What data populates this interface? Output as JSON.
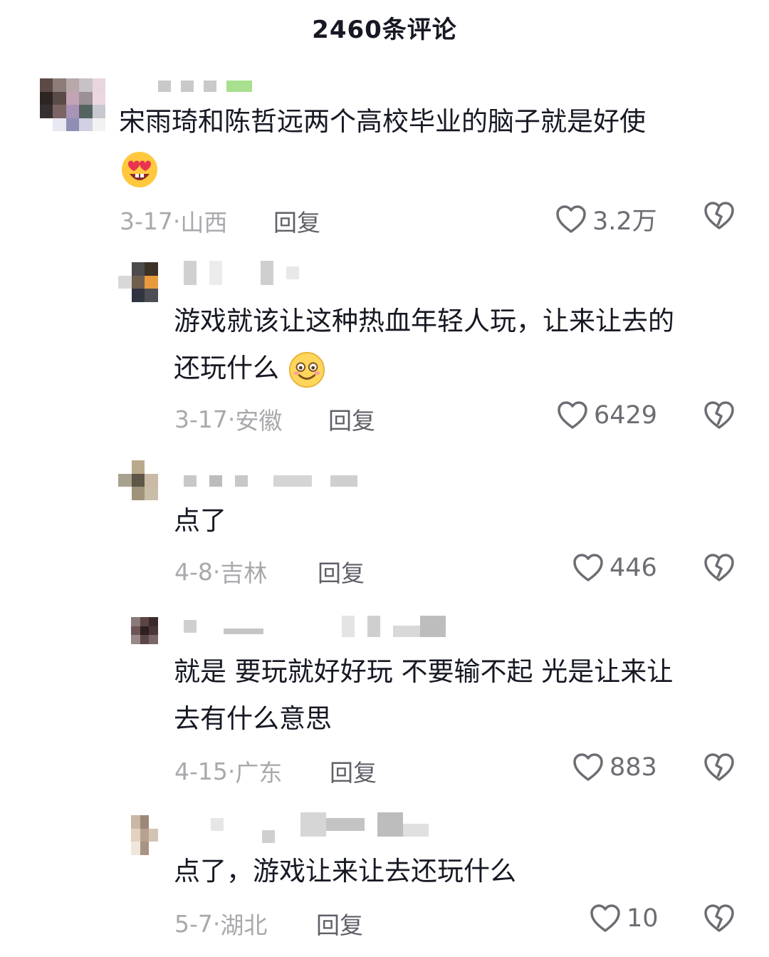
{
  "header": {
    "title": "2460条评论"
  },
  "comments": [
    {
      "text": "宋雨琦和陈哲远两个高校毕业的脑子就是好使",
      "emoji": "heart-eyes-emoji",
      "date": "3-17",
      "location": "山西",
      "reply": "回复",
      "likes": "3.2万"
    },
    {
      "text_line1": "游戏就该让这种热血年轻人玩，让来让去的",
      "text_line2": "还玩什么",
      "emoji": "smile-emoji",
      "date": "3-17",
      "location": "安徽",
      "reply": "回复",
      "likes": "6429"
    },
    {
      "text": "点了",
      "date": "4-8",
      "location": "吉林",
      "reply": "回复",
      "likes": "446"
    },
    {
      "text_line1": "就是 要玩就好好玩 不要输不起 光是让来让",
      "text_line2": "去有什么意思",
      "date": "4-15",
      "location": "广东",
      "reply": "回复",
      "likes": "883"
    },
    {
      "text": "点了，游戏让来让去还玩什么",
      "date": "5-7",
      "location": "湖北",
      "reply": "回复",
      "likes": "10"
    }
  ],
  "icons": {
    "like": "heart-outline-icon",
    "dislike": "broken-heart-icon"
  },
  "colors": {
    "text": "#161823",
    "meta": "#a9a9ad",
    "reply": "#5f6068"
  }
}
